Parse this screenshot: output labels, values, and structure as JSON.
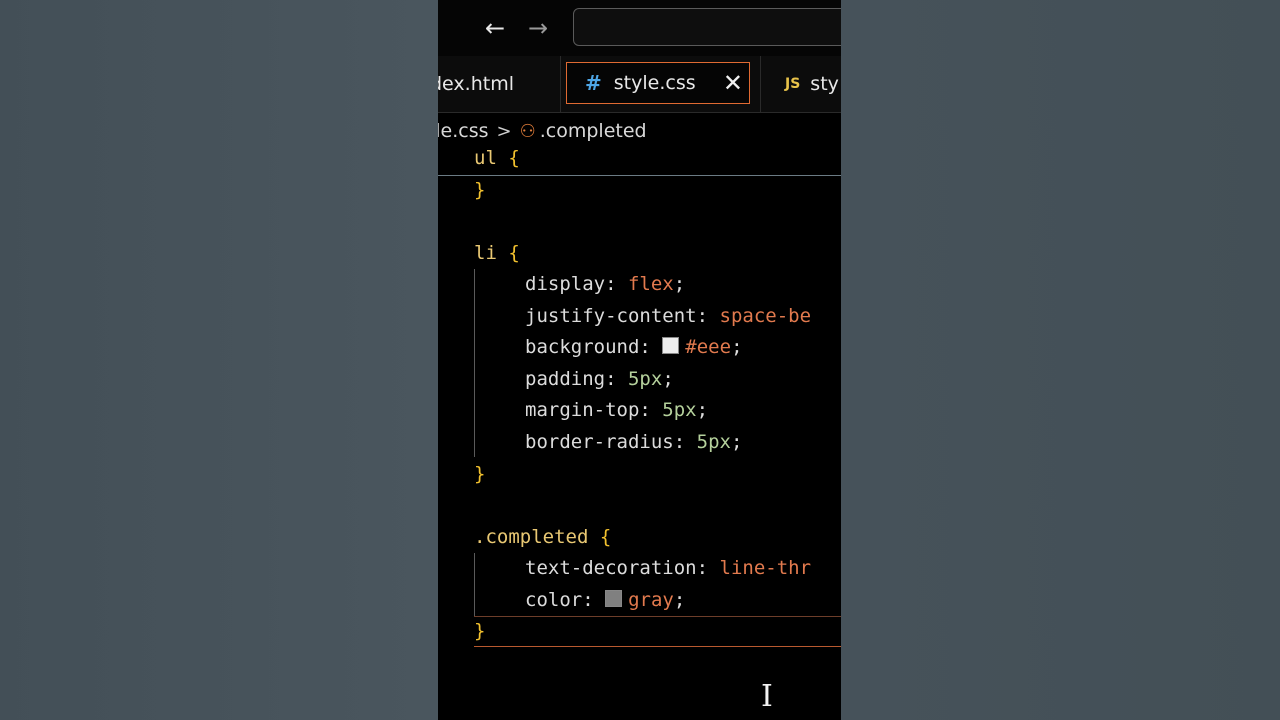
{
  "browser": {
    "back_icon": "arrow-left-icon",
    "forward_icon": "arrow-right-icon",
    "back_glyph": "←",
    "forward_glyph": "→"
  },
  "tabs": [
    {
      "label": "dex.html",
      "active": false
    },
    {
      "label": "style.css",
      "icon_text": "#",
      "close_glyph": "✕",
      "active": true
    },
    {
      "label": "sty",
      "icon_text": "JS",
      "active": false
    }
  ],
  "breadcrumb": {
    "file": "yle.css",
    "separator": ">",
    "symbol": ".completed",
    "symbol_icon": "⚇"
  },
  "code": {
    "sticky": {
      "selector": "ul",
      "brace": "{"
    },
    "l1": {
      "brace": "}"
    },
    "li_rule": {
      "selector": "li",
      "open": "{",
      "close": "}"
    },
    "d1": {
      "prop": "display",
      "value": "flex"
    },
    "d2": {
      "prop": "justify-content",
      "value": "space-be"
    },
    "d3": {
      "prop": "background",
      "value": "#eee",
      "swatch_color": "#eeeeee"
    },
    "d4": {
      "prop": "padding",
      "value": "5px"
    },
    "d5": {
      "prop": "margin-top",
      "value": "5px"
    },
    "d6": {
      "prop": "border-radius",
      "value": "5px"
    },
    "completed_rule": {
      "selector": ".completed",
      "open": "{",
      "close": "}"
    },
    "d7": {
      "prop": "text-decoration",
      "value": "line-thr"
    },
    "d8": {
      "prop": "color",
      "value": "gray",
      "swatch_color": "#808080"
    },
    "colon": ":",
    "semi": ";"
  },
  "colors": {
    "accent": "#e06a32",
    "selector": "#e9c873",
    "keyword_value": "#e27a4e",
    "number_value": "#b5d19c",
    "brace": "#f2c12e"
  },
  "cursor_icon": "text-cursor-icon"
}
